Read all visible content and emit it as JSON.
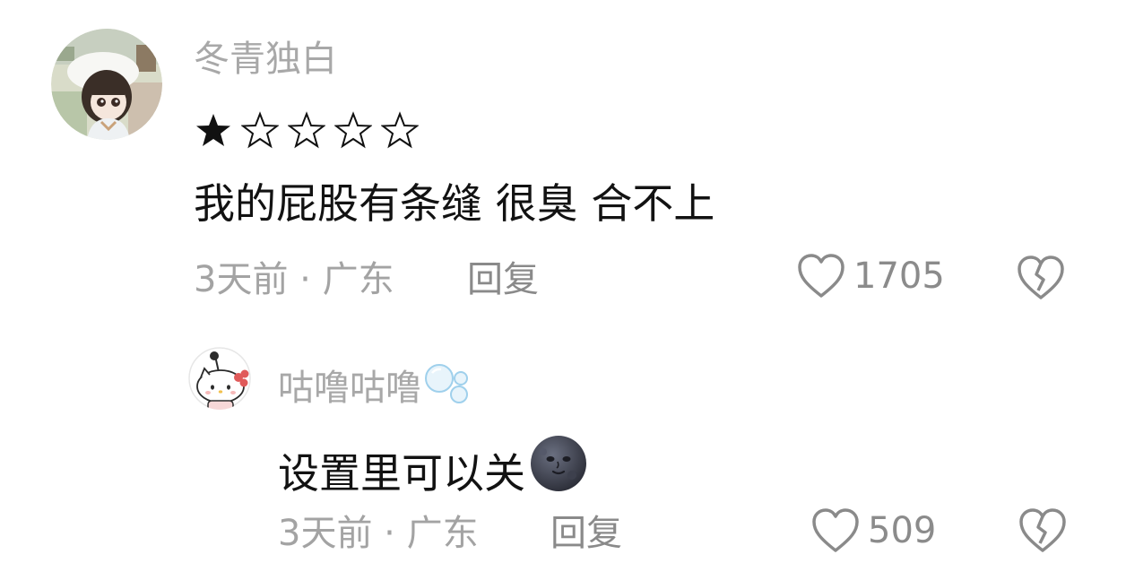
{
  "comments": [
    {
      "username": "冬青独白",
      "rating": 1,
      "rating_max": 5,
      "text": "我的屁股有条缝 很臭 合不上",
      "meta": "3天前 · 广东",
      "reply_label": "回复",
      "likes": "1705"
    },
    {
      "username": "咕噜咕噜",
      "username_icon": "bubbles-icon",
      "text": "设置里可以关",
      "text_emoji": "new-moon-face-emoji",
      "meta": "3天前 · 广东",
      "reply_label": "回复",
      "likes": "509"
    }
  ],
  "colors": {
    "background": "#ffffff",
    "username": "#a8a8a8",
    "body_text": "#121212",
    "meta": "#a3a3a3",
    "reply": "#8a8a8a",
    "like_count": "#8b8b8b",
    "icon_stroke": "#8a8a8a"
  },
  "icons": {
    "like": "heart-outline-icon",
    "dislike": "broken-heart-icon",
    "star_filled": "star-filled-icon",
    "star_empty": "star-outline-icon"
  }
}
